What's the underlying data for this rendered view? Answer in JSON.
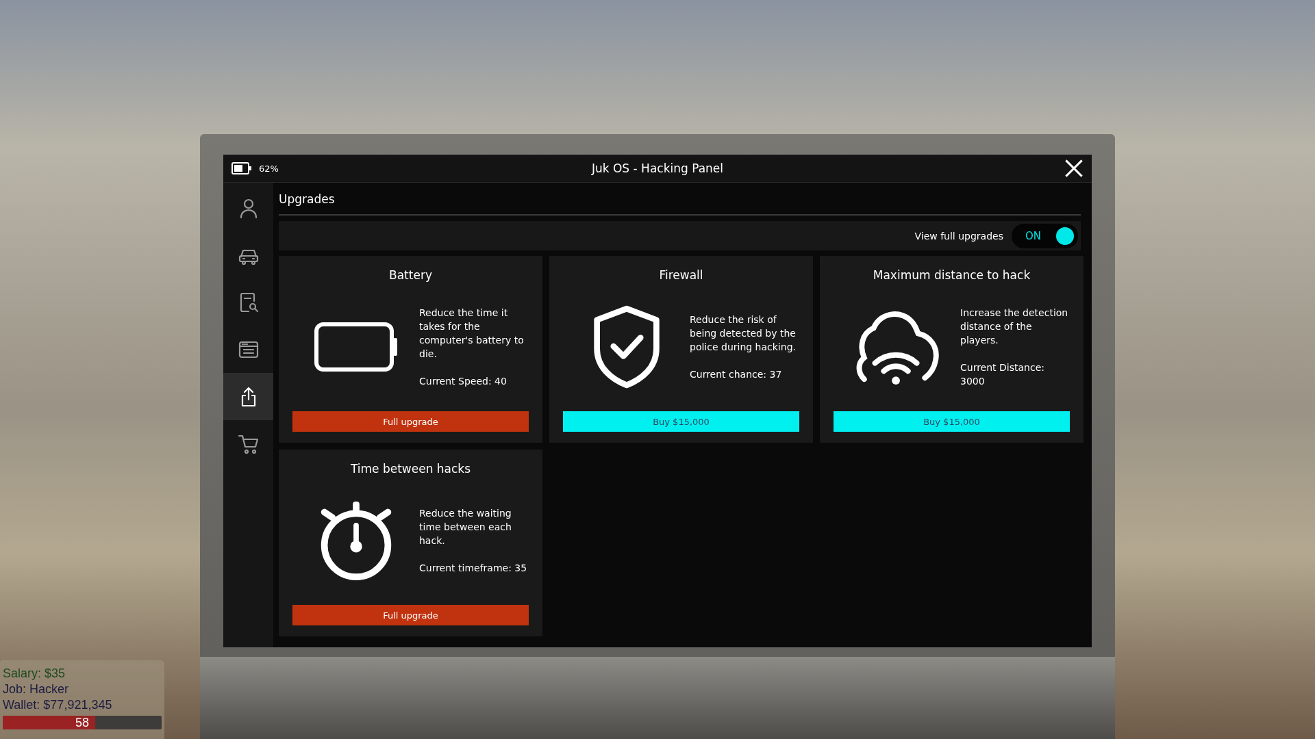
{
  "window": {
    "title": "Juk OS - Hacking Panel",
    "battery_text": "62%"
  },
  "sidebar": {
    "items": [
      {
        "selected": false
      },
      {
        "selected": false
      },
      {
        "selected": false
      },
      {
        "selected": false
      },
      {
        "selected": true
      },
      {
        "selected": false
      }
    ]
  },
  "section_title": "Upgrades",
  "toggle": {
    "label": "View full upgrades",
    "state_text": "ON",
    "on": true
  },
  "cards": [
    {
      "title": "Battery",
      "description": "Reduce the time it takes for the computer's battery to die.",
      "current": "Current Speed: 40",
      "button": {
        "label": "Full upgrade",
        "kind": "upgrade"
      }
    },
    {
      "title": "Firewall",
      "description": "Reduce the risk of being detected by the police during hacking.",
      "current": "Current chance: 37",
      "button": {
        "label": "Buy $15,000",
        "kind": "buy"
      }
    },
    {
      "title": "Maximum distance to hack",
      "description": "Increase the detection distance of the players.",
      "current": "Current Distance: 3000",
      "button": {
        "label": "Buy $15,000",
        "kind": "buy"
      }
    },
    {
      "title": "Time between hacks",
      "description": "Reduce the waiting time between each hack.",
      "current": "Current timeframe: 35",
      "button": {
        "label": "Full upgrade",
        "kind": "upgrade"
      }
    }
  ],
  "hud": {
    "salary": "Salary: $35",
    "job": "Job: Hacker",
    "wallet": "Wallet: $77,921,345",
    "health_text": "58",
    "level": 0.58
  }
}
